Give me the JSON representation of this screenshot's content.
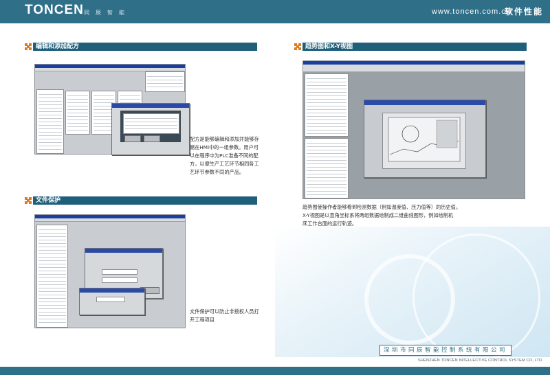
{
  "header": {
    "brand": "TONCEN",
    "brand_cn": "同辰智能",
    "website": "www.toncen.com.cn",
    "slogan": "软件性能"
  },
  "sections": [
    {
      "title": "编辑和添加配方",
      "text": [
        "配方是能够编辑和添加并能够存",
        "储在HMI中的一组参数。用户可",
        "以在程序中为PLC准备不同的配",
        "方，以便生产工艺环节相同各工",
        "艺环节参数不同的产品。"
      ]
    },
    {
      "title": "文件保护",
      "text": [
        "文件保护可以防止非授权人员打",
        "开工程项目"
      ]
    },
    {
      "title": "趋势图和X-Y视图",
      "text": [
        "趋势图使操作者能够看到检测数据（例如温度值、压力值等）的历史值。",
        "X-Y视图是以直角坐标系将两组数据绘制成二维曲线图形，例如绘制机",
        "床工作台面的运行轨迹。"
      ]
    }
  ],
  "footer": {
    "company_cn": "深圳市同辰智能控制系统有限公司",
    "company_en": "SHENZHEN TONCEN INTELLECTIVE CONTROL SYSTEM CO.,LTD."
  },
  "colors": {
    "header": "#2f6f88",
    "section_bar": "#1f5f7a",
    "bullet": "#e07a1a"
  }
}
